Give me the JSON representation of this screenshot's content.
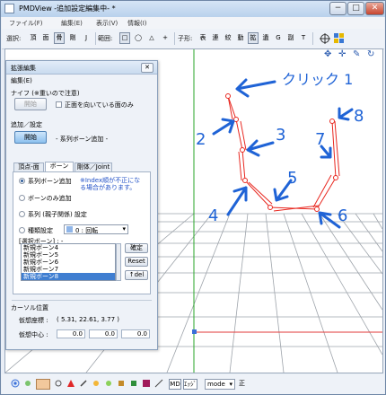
{
  "window": {
    "title": "PMDView -追加設定編集中- *",
    "buttons": [
      "−",
      "□",
      "✕"
    ]
  },
  "menubar": [
    "ファイル(F)",
    "編集(E)",
    "表示(V)",
    "情報(I)"
  ],
  "toolbar": {
    "select_label": "選択:",
    "select_buttons": [
      "頂",
      "面",
      "骨",
      "剛",
      "J"
    ],
    "range_label": "範囲:",
    "range_buttons": [
      "□",
      "◯",
      "△",
      "+"
    ],
    "child_label": "子形:",
    "child_buttons": [
      "表",
      "連",
      "絞",
      "動",
      "拡",
      "遺",
      "G",
      "副",
      "T"
    ],
    "right_icons": [
      "move-icon",
      "move-all-icon",
      "pen-icon",
      "rotate-icon"
    ]
  },
  "panel": {
    "title": "拡張編集",
    "menu": "編集(E)",
    "knife_label": "ナイフ (※重いので注意)",
    "knife_start_button": "開始",
    "front_only_label": "正面を向いている面のみ",
    "add_setting_label": "追加／設定",
    "add_start_button": "開始",
    "add_mode_text": "- 系列ボーン追加 -",
    "tabs": [
      "頂点-面",
      "ボーン",
      "剛体／Joint"
    ],
    "radios": [
      "系列ボーン追加",
      "ボーンのみ追加",
      "系列 (親子関係) 設定",
      "種類設定"
    ],
    "warning": "※Index順が不正になる場合があります。",
    "type_value": "0 : 回転",
    "selected_bone_label": "[選択ボーン] : -",
    "bone_list": [
      "新規ボーン4",
      "新規ボーン5",
      "新規ボーン6",
      "新規ボーン7",
      "新規ボーン8"
    ],
    "selected_bone": "新規ボーン8",
    "side_buttons": [
      "確定",
      "Reset",
      "↑del"
    ],
    "cursor_section": "カーソル位置",
    "virtual_coord_label": "仮想座標 :",
    "virtual_coord_value": "( 5.31, 22.61, 3.77 )",
    "virtual_center_label": "仮想中心 :",
    "virtual_center_values": [
      "0.0",
      "0.0",
      "0.0"
    ]
  },
  "annotations": {
    "click_label": "クリック 1",
    "numbers": [
      "2",
      "3",
      "4",
      "5",
      "6",
      "7",
      "8"
    ]
  },
  "bottombar": {
    "mode_label": "mode",
    "right_label": "正",
    "buttons": [
      "MD",
      "ｴｯｼﾞ"
    ]
  },
  "colors": {
    "bone_line": "#e8271f",
    "annotation": "#1f63d6",
    "grid": "#9ea4ab",
    "axis_green": "#2aa62a",
    "axis_red": "#e23a3a"
  }
}
